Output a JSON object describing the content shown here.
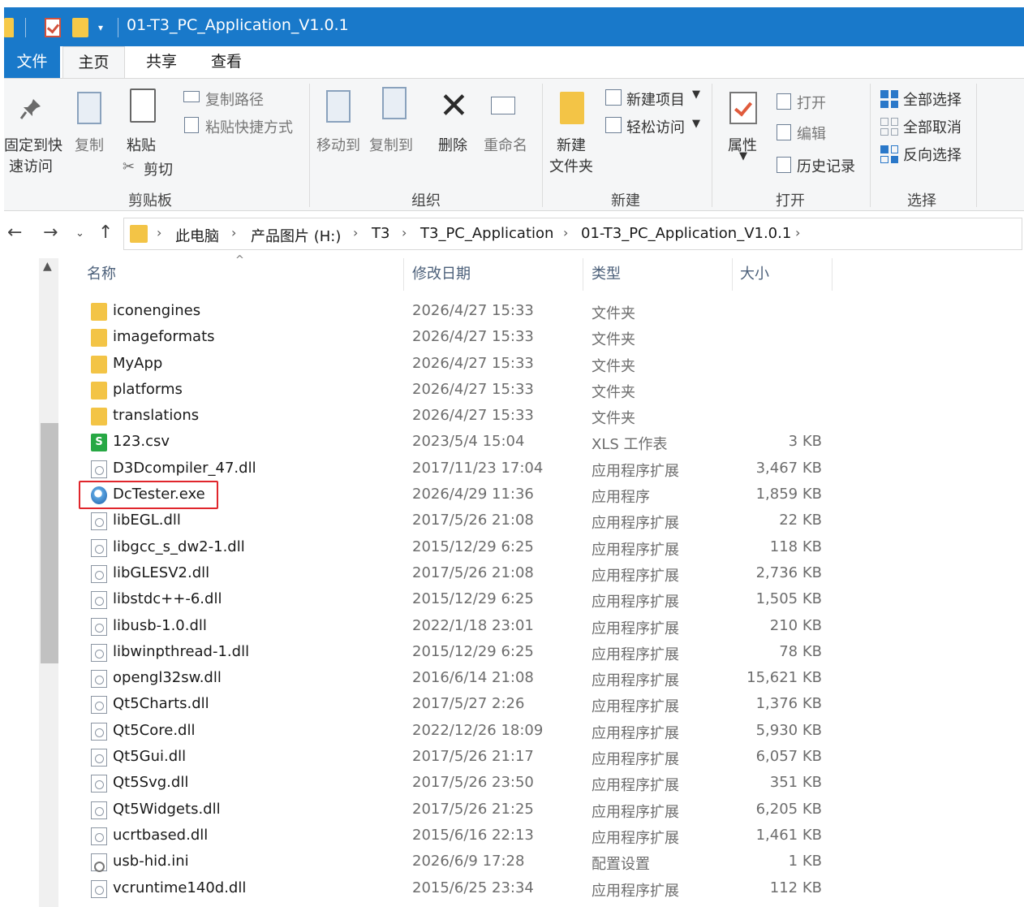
{
  "window": {
    "title": "01-T3_PC_Application_V1.0.1"
  },
  "tabs": {
    "file": "文件",
    "home": "主页",
    "share": "共享",
    "view": "查看"
  },
  "ribbon": {
    "clipboard": {
      "label": "剪贴板",
      "pin_line1": "固定到快",
      "pin_line2": "速访问",
      "copy": "复制",
      "paste": "粘贴",
      "copy_path": "复制路径",
      "paste_shortcut": "粘贴快捷方式",
      "cut": "剪切"
    },
    "organize": {
      "label": "组织",
      "move_to": "移动到",
      "copy_to": "复制到",
      "delete": "删除",
      "rename": "重命名"
    },
    "new": {
      "label": "新建",
      "new_folder_line1": "新建",
      "new_folder_line2": "文件夹",
      "new_item": "新建项目",
      "easy_access": "轻松访问"
    },
    "open": {
      "label": "打开",
      "properties": "属性",
      "open": "打开",
      "edit": "编辑",
      "history": "历史记录"
    },
    "select": {
      "label": "选择",
      "select_all": "全部选择",
      "select_none": "全部取消",
      "invert": "反向选择"
    }
  },
  "breadcrumb": [
    "此电脑",
    "产品图片 (H:)",
    "T3",
    "T3_PC_Application",
    "01-T3_PC_Application_V1.0.1"
  ],
  "columns": {
    "name": "名称",
    "date": "修改日期",
    "type": "类型",
    "size": "大小"
  },
  "files": [
    {
      "name": "iconengines",
      "date": "2026/4/27 15:33",
      "type": "文件夹",
      "size": "",
      "icon": "folder"
    },
    {
      "name": "imageformats",
      "date": "2026/4/27 15:33",
      "type": "文件夹",
      "size": "",
      "icon": "folder"
    },
    {
      "name": "MyApp",
      "date": "2026/4/27 15:33",
      "type": "文件夹",
      "size": "",
      "icon": "folder"
    },
    {
      "name": "platforms",
      "date": "2026/4/27 15:33",
      "type": "文件夹",
      "size": "",
      "icon": "folder"
    },
    {
      "name": "translations",
      "date": "2026/4/27 15:33",
      "type": "文件夹",
      "size": "",
      "icon": "folder"
    },
    {
      "name": "123.csv",
      "date": "2023/5/4 15:04",
      "type": "XLS 工作表",
      "size": "3 KB",
      "icon": "csv"
    },
    {
      "name": "D3Dcompiler_47.dll",
      "date": "2017/11/23 17:04",
      "type": "应用程序扩展",
      "size": "3,467 KB",
      "icon": "dll"
    },
    {
      "name": "DcTester.exe",
      "date": "2026/4/29 11:36",
      "type": "应用程序",
      "size": "1,859 KB",
      "icon": "exe"
    },
    {
      "name": "libEGL.dll",
      "date": "2017/5/26 21:08",
      "type": "应用程序扩展",
      "size": "22 KB",
      "icon": "dll"
    },
    {
      "name": "libgcc_s_dw2-1.dll",
      "date": "2015/12/29 6:25",
      "type": "应用程序扩展",
      "size": "118 KB",
      "icon": "dll"
    },
    {
      "name": "libGLESV2.dll",
      "date": "2017/5/26 21:08",
      "type": "应用程序扩展",
      "size": "2,736 KB",
      "icon": "dll"
    },
    {
      "name": "libstdc++-6.dll",
      "date": "2015/12/29 6:25",
      "type": "应用程序扩展",
      "size": "1,505 KB",
      "icon": "dll"
    },
    {
      "name": "libusb-1.0.dll",
      "date": "2022/1/18 23:01",
      "type": "应用程序扩展",
      "size": "210 KB",
      "icon": "dll"
    },
    {
      "name": "libwinpthread-1.dll",
      "date": "2015/12/29 6:25",
      "type": "应用程序扩展",
      "size": "78 KB",
      "icon": "dll"
    },
    {
      "name": "opengl32sw.dll",
      "date": "2016/6/14 21:08",
      "type": "应用程序扩展",
      "size": "15,621 KB",
      "icon": "dll"
    },
    {
      "name": "Qt5Charts.dll",
      "date": "2017/5/27 2:26",
      "type": "应用程序扩展",
      "size": "1,376 KB",
      "icon": "dll"
    },
    {
      "name": "Qt5Core.dll",
      "date": "2022/12/26 18:09",
      "type": "应用程序扩展",
      "size": "5,930 KB",
      "icon": "dll"
    },
    {
      "name": "Qt5Gui.dll",
      "date": "2017/5/26 21:17",
      "type": "应用程序扩展",
      "size": "6,057 KB",
      "icon": "dll"
    },
    {
      "name": "Qt5Svg.dll",
      "date": "2017/5/26 23:50",
      "type": "应用程序扩展",
      "size": "351 KB",
      "icon": "dll"
    },
    {
      "name": "Qt5Widgets.dll",
      "date": "2017/5/26 21:25",
      "type": "应用程序扩展",
      "size": "6,205 KB",
      "icon": "dll"
    },
    {
      "name": "ucrtbased.dll",
      "date": "2015/6/16 22:13",
      "type": "应用程序扩展",
      "size": "1,461 KB",
      "icon": "dll"
    },
    {
      "name": "usb-hid.ini",
      "date": "2026/6/9 17:28",
      "type": "配置设置",
      "size": "1 KB",
      "icon": "ini"
    },
    {
      "name": "vcruntime140d.dll",
      "date": "2015/6/25 23:34",
      "type": "应用程序扩展",
      "size": "112 KB",
      "icon": "dll"
    }
  ],
  "colors": {
    "titlebar": "#1979ca",
    "highlight": "#e0262c",
    "folder": "#f3c446"
  }
}
